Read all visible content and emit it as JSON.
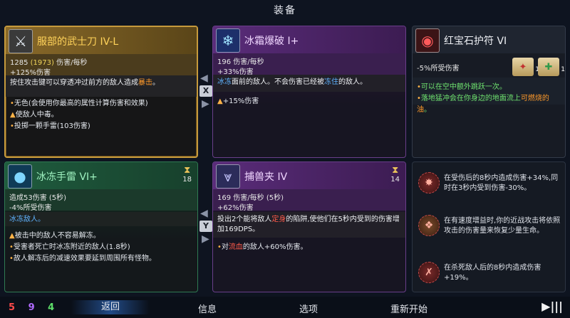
{
  "screen_title": "装备",
  "cards": {
    "weapon1": {
      "name": "服部的武士刀 IV-L",
      "stat_line_dps": "1285",
      "stat_line_dps_alt": "(1973)",
      "stat_line_unit": " 伤害/每秒",
      "stat_line_bonus": "+125%伤害",
      "desc_a": "按住攻击键可以穿透冲过前方的敌人造成",
      "desc_b": "暴击",
      "desc_c": "。",
      "effects": [
        "无色(会使用你最高的属性计算伤害和效果)",
        "使敌人中毒。",
        "投掷一颗手雷(103伤害)"
      ]
    },
    "weapon2": {
      "name": "冰霜爆破 I+",
      "stat_line_dps": "196 伤害/每秒",
      "stat_line_bonus": "+33%伤害",
      "desc_a": "冰冻",
      "desc_b": "面前的敌人。不会伤害已经被",
      "desc_c": "冻住",
      "desc_d": "的敌人。",
      "effects": [
        "+15%伤害"
      ]
    },
    "amulet": {
      "name": "红宝石护符 VI",
      "stat_bonus": "-5%所受伤害",
      "scroll_counts": [
        "1",
        "1"
      ],
      "effect_a": "可以在空中额外跳跃一次。",
      "effect_b": "落地猛冲会在你身边的地面流上",
      "effect_c": "可燃烧的油",
      "effect_d": "。"
    },
    "skill1": {
      "name": "冰冻手雷 VI+",
      "timer": "18",
      "stat_a": "造成53伤害 (5秒)",
      "stat_b": "-4%所受伤害",
      "desc": "冰冻敌人。",
      "effects": [
        "被击中的敌人不容易解冻。",
        "受害者死亡时冰冻附近的敌人(1.8秒)",
        "故人解冻后的减速效果要延到周围所有怪物。"
      ]
    },
    "skill2": {
      "name": "捕兽夹 IV",
      "timer": "14",
      "stat_a": "169 伤害/每秒 (5秒)",
      "stat_b": "+62%伤害",
      "desc_a": "投出2个能将敌人",
      "desc_b": "定身",
      "desc_c": "的陷阱,使他们在5秒内受到的伤害增加169DPS。",
      "effect_a": "对",
      "effect_b": "流血",
      "effect_c": "的敌人+60%伤害。"
    }
  },
  "swap_buttons": [
    "X",
    "Y"
  ],
  "mutations": [
    "在受伤后的8秒内造成伤害+34%,同时在3秒内受到伤害-30%。",
    "在有速度增益时,你的近战攻击将依照攻击的伤害量来恢复少量生命。",
    "在杀死敌人后的8秒内造成伤害+19%。"
  ],
  "bottom": {
    "stats": [
      "5",
      "9",
      "4"
    ],
    "back": "返回",
    "info": "信息",
    "options": "选项",
    "restart": "重新开始",
    "watermark": "▶|||"
  },
  "colors": {
    "brutality": "#ff4a4a",
    "tactics": "#b06bff",
    "survival": "#5ee06a",
    "legendary_border": "#c69a3c"
  },
  "icons": {
    "weapon1": "katana-icon",
    "weapon2": "frost-blast-icon",
    "amulet": "amulet-icon",
    "skill1": "ice-grenade-icon",
    "skill2": "wolf-trap-icon",
    "timer": "hourglass-icon",
    "mutation": "mutation-icon"
  }
}
